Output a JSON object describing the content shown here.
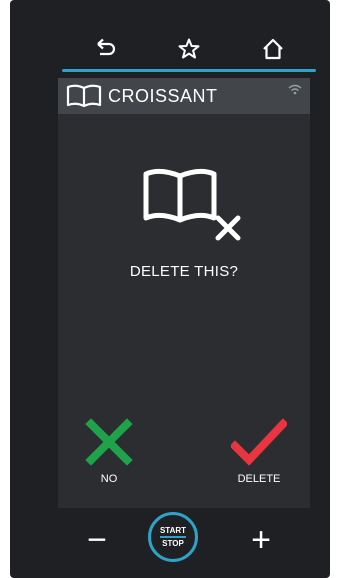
{
  "nav": {
    "back_icon": "back-arrow-icon",
    "favorite_icon": "star-icon",
    "home_icon": "home-icon"
  },
  "header": {
    "title": "CROISSANT",
    "icon": "book-icon",
    "status_icon": "wifi-icon"
  },
  "dialog": {
    "icon": "book-delete-icon",
    "question": "DELETE THIS?",
    "no_label": "NO",
    "delete_label": "DELETE"
  },
  "controls": {
    "minus_label": "−",
    "plus_label": "+",
    "start_label": "START",
    "stop_label": "STOP"
  },
  "colors": {
    "accent": "#2ea3c7",
    "no": "#1fa34a",
    "delete": "#e8353f",
    "background": "#1e2024",
    "screen": "#2b2d31",
    "header": "#42464b"
  }
}
